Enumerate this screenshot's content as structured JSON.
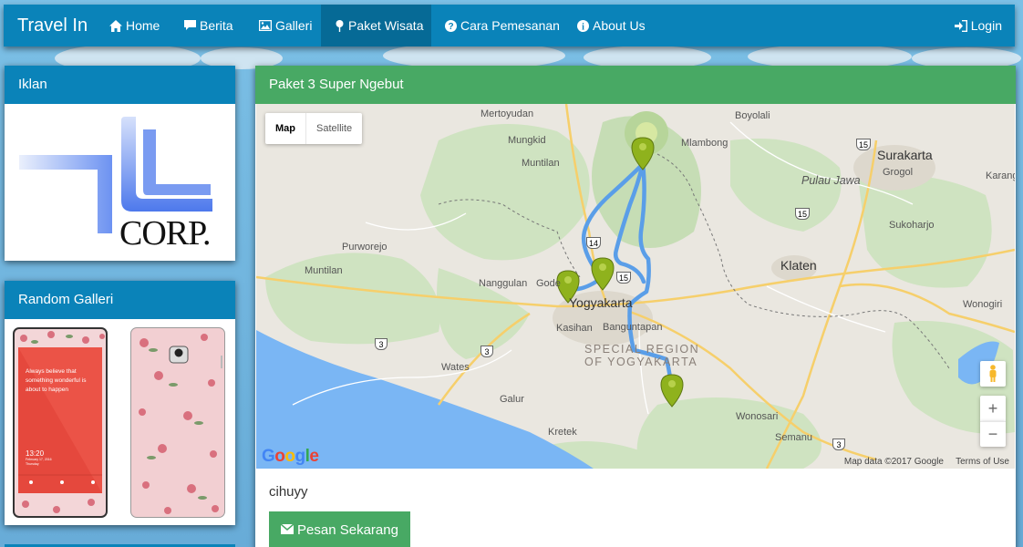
{
  "navbar": {
    "brand": "Travel In",
    "items": [
      {
        "label": "Home",
        "icon": "home-icon"
      },
      {
        "label": "Berita",
        "icon": "comment-icon"
      },
      {
        "label": "Galleri",
        "icon": "picture-icon"
      },
      {
        "label": "Paket Wisata",
        "icon": "pushpin-icon",
        "active": true
      },
      {
        "label": "Cara Pemesanan",
        "icon": "question-icon"
      },
      {
        "label": "About Us",
        "icon": "info-icon"
      }
    ],
    "login": "Login"
  },
  "sidebar": {
    "ad": {
      "title": "Iklan",
      "logo_text": "CORP."
    },
    "gallery": {
      "title": "Random Galleri",
      "phone_text": "Always believe that something wonderful is about to happen",
      "phone_time": "13:20",
      "phone_date": "February 17, 2016",
      "phone_day": "Thursday"
    }
  },
  "main": {
    "title": "Paket 3 Super Ngebut",
    "description": "cihuyy",
    "order_button": "Pesan Sekarang"
  },
  "map": {
    "type_map": "Map",
    "type_satellite": "Satellite",
    "zoom_in": "+",
    "zoom_out": "−",
    "data_credit": "Map data ©2017 Google",
    "terms": "Terms of Use",
    "labels": {
      "mertoyudan": "Mertoyudan",
      "mungkid": "Mungkid",
      "muntilan": "Muntilan",
      "boyolali": "Boyolali",
      "mlambong": "Mlambong",
      "surakarta": "Surakarta",
      "grogol": "Grogol",
      "karang": "Karang",
      "pulau_jawa": "Pulau Jawa",
      "sukoharjo": "Sukoharjo",
      "purworejo": "Purworejo",
      "muntilan2": "Muntilan",
      "nanggulan": "Nanggulan",
      "godean": "Gode",
      "yogyakarta": "Yogyakarta",
      "banguntapan": "Banguntapan",
      "kasihan": "Kasihan",
      "klaten": "Klaten",
      "wonogiri": "Wonogiri",
      "region1": "SPECIAL REGION",
      "region2": "OF YOGYAKARTA",
      "wates": "Wates",
      "galur": "Galur",
      "kretek": "Kretek",
      "wonosari": "Wonosari",
      "semanu": "Semanu"
    },
    "road_shields": [
      "15",
      "15",
      "14",
      "15",
      "3",
      "3",
      "3"
    ],
    "colors": {
      "land": "#eae7e0",
      "green": "#cfe3c1",
      "water": "#7ab6f4",
      "route": "#5a9ee8",
      "pin": "#8fb21d"
    }
  },
  "colors": {
    "nav": "#0a83b9",
    "nav_active": "#066a96",
    "panel_green": "#48a964"
  }
}
